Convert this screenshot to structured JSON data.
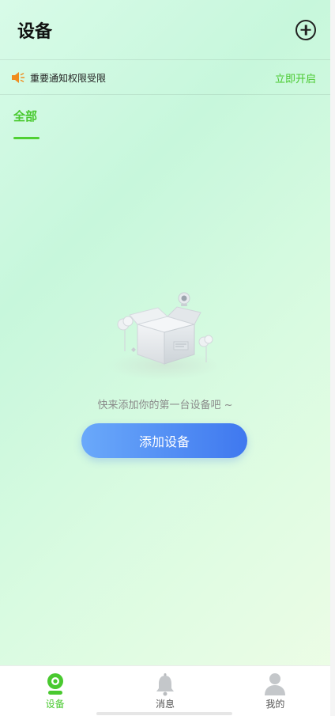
{
  "header": {
    "title": "设备",
    "add_icon": "plus-circle-icon"
  },
  "notice": {
    "icon": "speaker-icon",
    "text": "重要通知权限受限",
    "action": "立即开启",
    "icon_color": "#f08c1e",
    "action_color": "#49c92f"
  },
  "tabs": [
    {
      "label": "全部",
      "active": true
    }
  ],
  "empty_state": {
    "illustration": "empty-box-icon",
    "message": "快来添加你的第一台设备吧 ~",
    "button_label": "添加设备"
  },
  "bottom_nav": {
    "items": [
      {
        "label": "设备",
        "icon": "camera-icon",
        "active": true
      },
      {
        "label": "消息",
        "icon": "bell-icon",
        "active": false
      },
      {
        "label": "我的",
        "icon": "user-icon",
        "active": false
      }
    ]
  },
  "colors": {
    "accent": "#49c92f",
    "button_start": "#6aa9fa",
    "button_end": "#3f78ef"
  }
}
